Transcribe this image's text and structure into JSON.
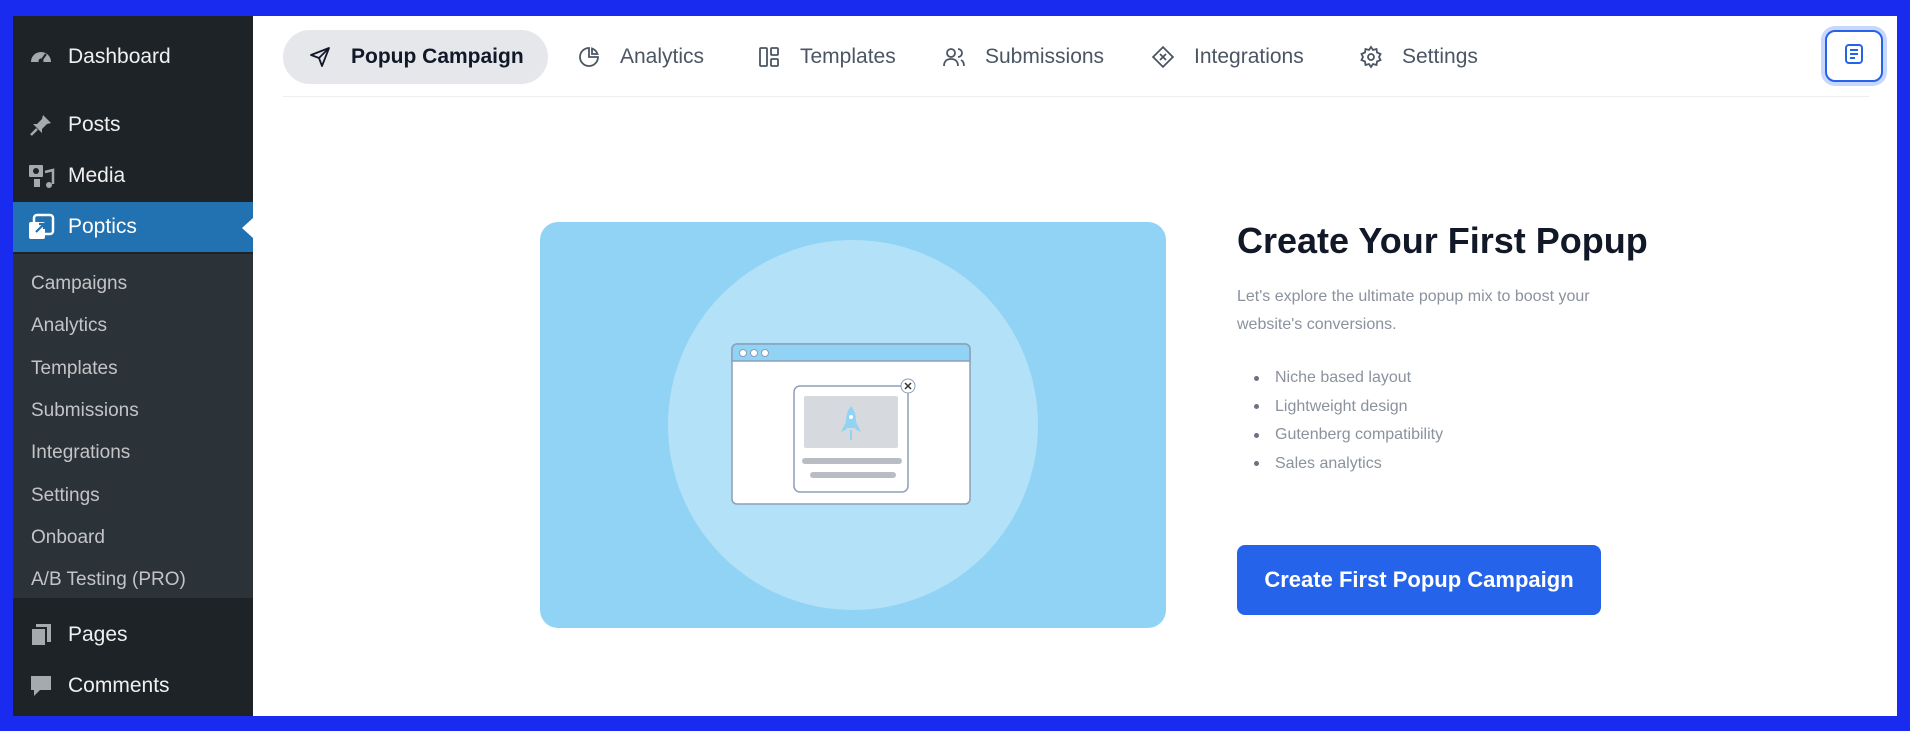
{
  "sidebar": {
    "dashboard": "Dashboard",
    "posts": "Posts",
    "media": "Media",
    "poptics": "Poptics",
    "submenu": [
      "Campaigns",
      "Analytics",
      "Templates",
      "Submissions",
      "Integrations",
      "Settings",
      "Onboard",
      "A/B Testing (PRO)"
    ],
    "pages": "Pages",
    "comments": "Comments"
  },
  "tabs": [
    "Popup Campaign",
    "Analytics",
    "Templates",
    "Submissions",
    "Integrations",
    "Settings"
  ],
  "hero": {
    "title": "Create Your First Popup",
    "subtitle": "Let's explore the ultimate popup mix to boost your website's conversions.",
    "features": [
      "Niche based layout",
      "Lightweight design",
      "Gutenberg compatibility",
      "Sales analytics"
    ],
    "cta": "Create First Popup Campaign"
  },
  "colors": {
    "accent": "#2563eb",
    "sidebar_bg": "#1d2327",
    "sidebar_active": "#2271b1",
    "illustration_bg": "#90d3f4"
  }
}
